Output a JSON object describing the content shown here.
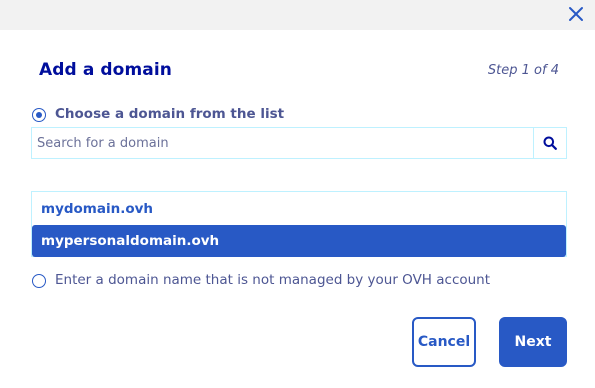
{
  "dialog": {
    "title": "Add a domain",
    "step": "Step 1 of 4"
  },
  "options": {
    "list_label": "Choose a domain from the list",
    "other_label": "Enter a domain name that is not managed by your OVH account",
    "selected": "list"
  },
  "search": {
    "placeholder": "Search for a domain",
    "value": ""
  },
  "domains": [
    {
      "name": "mydomain.ovh",
      "selected": false
    },
    {
      "name": "mypersonaldomain.ovh",
      "selected": true
    }
  ],
  "buttons": {
    "cancel": "Cancel",
    "next": "Next"
  },
  "icons": {
    "close": "close-icon",
    "search": "search-icon"
  },
  "colors": {
    "primary": "#2859c5",
    "title": "#000e9c",
    "text": "#4d5693",
    "border": "#bef1ff",
    "topbar": "#f2f2f2"
  }
}
